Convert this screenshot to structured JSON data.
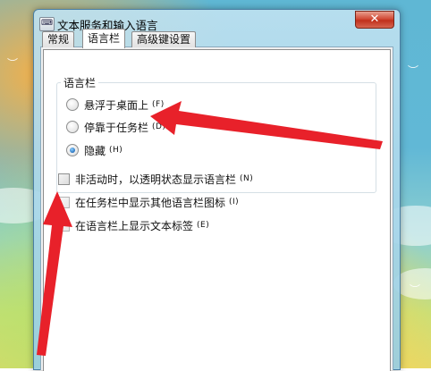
{
  "window": {
    "title": "文本服务和输入语言",
    "app_icon": "keyboard-icon",
    "close_glyph": "✕"
  },
  "tabs": [
    {
      "label": "常规",
      "active": false
    },
    {
      "label": "语言栏",
      "active": true
    },
    {
      "label": "高级键设置",
      "active": false
    }
  ],
  "language_bar_group": {
    "label": "语言栏",
    "options": [
      {
        "label": "悬浮于桌面上",
        "hotkey": "(F)",
        "checked": false
      },
      {
        "label": "停靠于任务栏",
        "hotkey": "(D)",
        "checked": false
      },
      {
        "label": "隐藏",
        "hotkey": "(H)",
        "checked": true
      }
    ]
  },
  "checkboxes": [
    {
      "label": "非活动时，以透明状态显示语言栏",
      "hotkey": "(N)",
      "checked": false
    },
    {
      "label": "在任务栏中显示其他语言栏图标",
      "hotkey": "(I)",
      "checked": false
    },
    {
      "label": "在语言栏上显示文本标签",
      "hotkey": "(E)",
      "checked": false
    }
  ],
  "annotations": {
    "arrow_color": "#e8212a"
  }
}
